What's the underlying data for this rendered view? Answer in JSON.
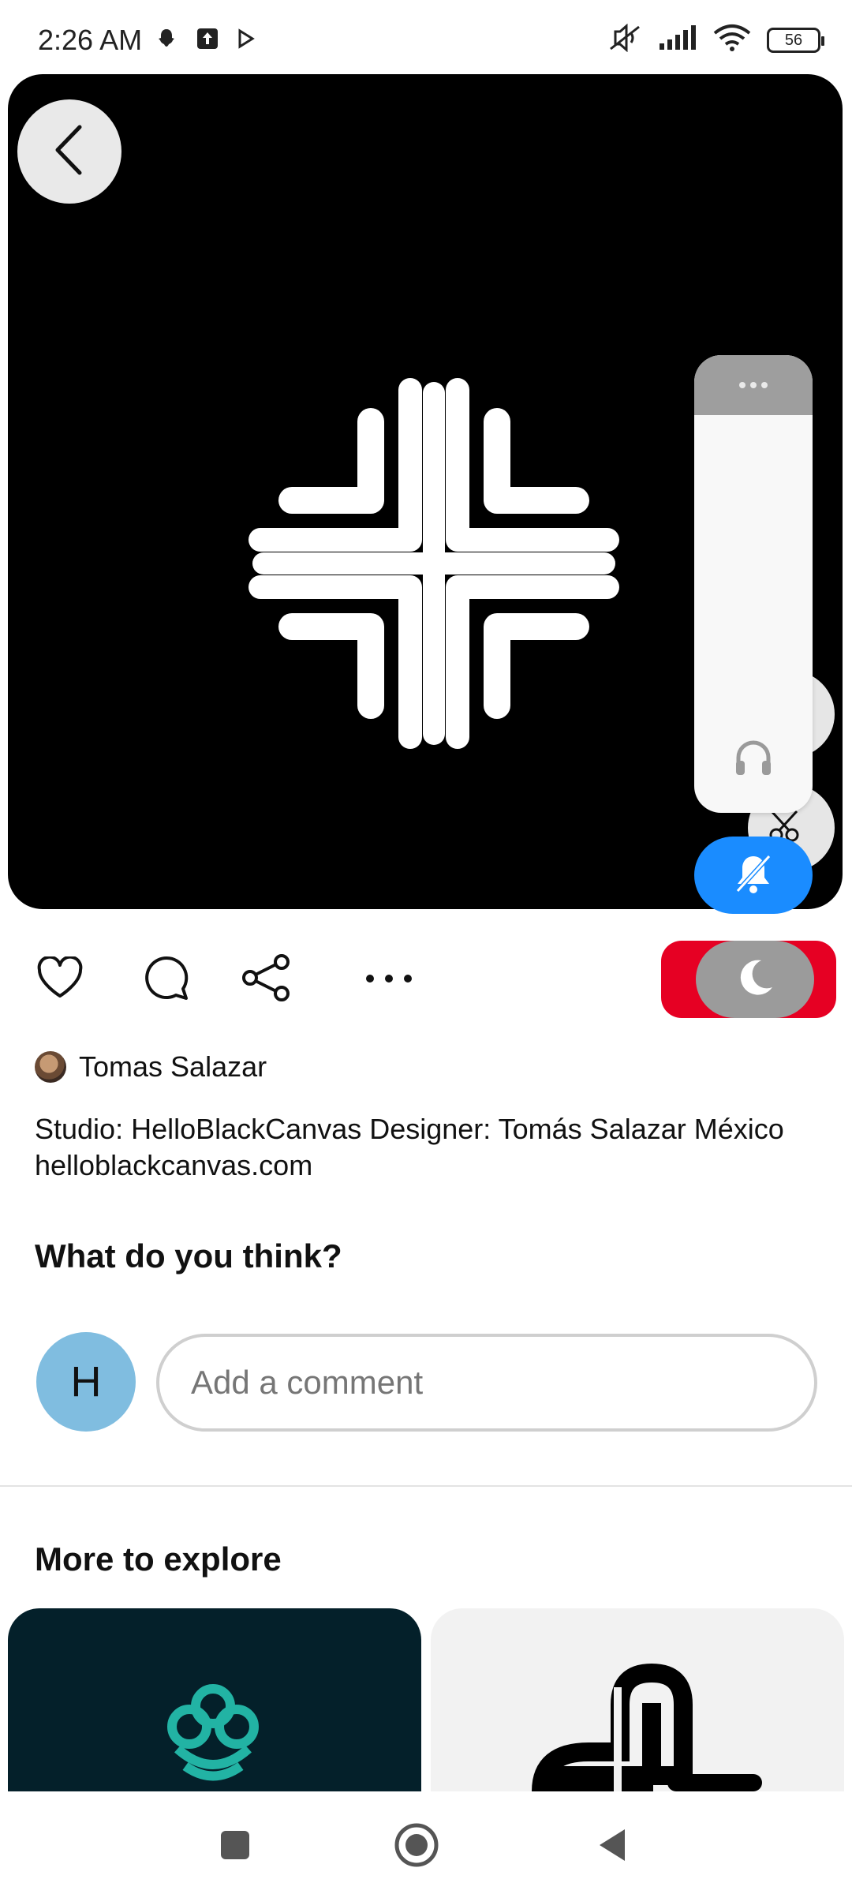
{
  "status_bar": {
    "time": "2:26 AM",
    "battery": "56",
    "icons_left": [
      "snapchat-icon",
      "upload-icon",
      "play-store-icon"
    ],
    "icons_right": [
      "mute-icon",
      "signal-icon",
      "wifi-icon",
      "battery-icon"
    ]
  },
  "hero": {
    "background_color": "#000000",
    "back_icon": "chevron-left-icon",
    "image_subject": "white interlocking cross logo on black"
  },
  "side_panel": {
    "menu_icon": "more-horizontal-icon",
    "headphone_icon": "headphones-icon",
    "scissors_icon": "scissors-icon",
    "bell_icon": "bell-off-icon",
    "moon_icon": "moon-icon",
    "bell_button_color": "#1a8cff",
    "toggle_color": "#e60023"
  },
  "actions": {
    "like_icon": "heart-icon",
    "comment_icon": "comment-icon",
    "share_icon": "share-icon",
    "more_icon": "more-horizontal-icon"
  },
  "author": {
    "name": "Tomas Salazar"
  },
  "description": "Studio: HelloBlackCanvas Designer: Tomás Salazar México helloblackcanvas.com",
  "comments": {
    "title": "What do you think?",
    "user_initial": "H",
    "placeholder": "Add a comment"
  },
  "explore": {
    "title": "More to explore"
  },
  "nav_bar": {
    "icons": [
      "recents-square-icon",
      "home-circle-icon",
      "back-triangle-icon"
    ]
  }
}
